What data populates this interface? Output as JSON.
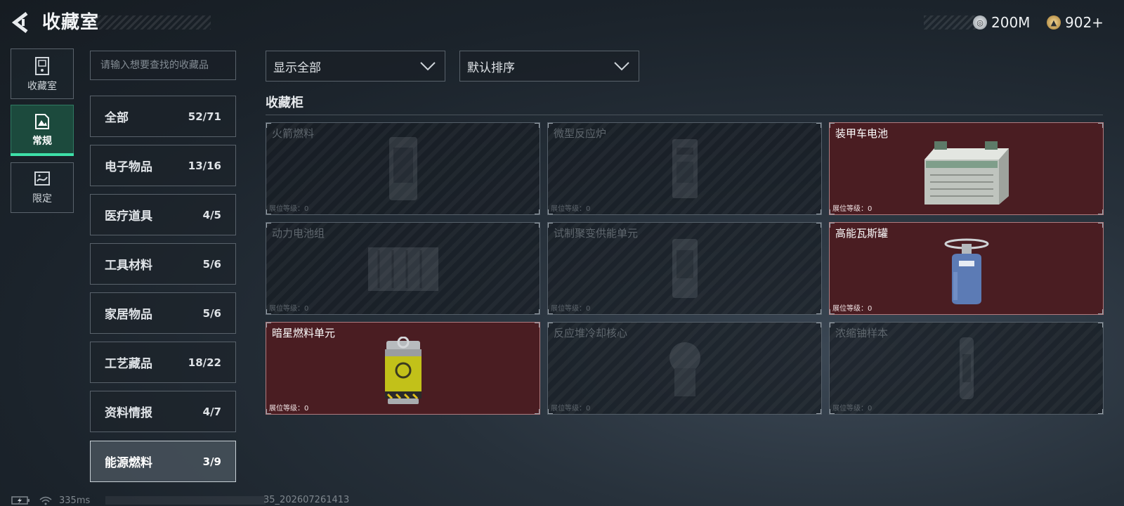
{
  "header": {
    "title": "收藏室"
  },
  "currency": [
    {
      "value": "200M",
      "icon": "silver-coin-icon",
      "color": "#c9ced3"
    },
    {
      "value": "902+",
      "icon": "gold-coin-icon",
      "color": "#d9b36a"
    }
  ],
  "nav": [
    {
      "label": "收藏室",
      "icon": "vault-icon",
      "active": false
    },
    {
      "label": "常规",
      "icon": "regular-icon",
      "active": true
    },
    {
      "label": "限定",
      "icon": "limited-icon",
      "active": false
    }
  ],
  "search": {
    "placeholder": "请输入想要查找的收藏品"
  },
  "categories": [
    {
      "name": "全部",
      "count": "52/71"
    },
    {
      "name": "电子物品",
      "count": "13/16"
    },
    {
      "name": "医疗道具",
      "count": "4/5"
    },
    {
      "name": "工具材料",
      "count": "5/6"
    },
    {
      "name": "家居物品",
      "count": "5/6"
    },
    {
      "name": "工艺藏品",
      "count": "18/22"
    },
    {
      "name": "资料情报",
      "count": "4/7"
    },
    {
      "name": "能源燃料",
      "count": "3/9",
      "active": true
    }
  ],
  "filters": {
    "show": "显示全部",
    "sort": "默认排序"
  },
  "section": {
    "title": "收藏柜"
  },
  "items": [
    {
      "name": "火箭燃料",
      "level": "展位等级：0",
      "owned": false,
      "icon": "rocket-fuel-icon"
    },
    {
      "name": "微型反应炉",
      "level": "展位等级：0",
      "owned": false,
      "icon": "mini-reactor-icon"
    },
    {
      "name": "装甲车电池",
      "level": "展位等级：0",
      "owned": true,
      "icon": "armored-battery-icon"
    },
    {
      "name": "动力电池组",
      "level": "展位等级：0",
      "owned": false,
      "icon": "power-battery-pack-icon"
    },
    {
      "name": "试制聚变供能单元",
      "level": "展位等级：0",
      "owned": false,
      "icon": "fusion-unit-icon"
    },
    {
      "name": "高能瓦斯罐",
      "level": "展位等级：0",
      "owned": true,
      "icon": "gas-canister-icon"
    },
    {
      "name": "暗星燃料单元",
      "level": "展位等级：0",
      "owned": true,
      "icon": "darkstar-fuel-cell-icon"
    },
    {
      "name": "反应堆冷却核心",
      "level": "展位等级：0",
      "owned": false,
      "icon": "reactor-cooling-core-icon"
    },
    {
      "name": "浓缩铀样本",
      "level": "展位等级：0",
      "owned": false,
      "icon": "uranium-sample-icon"
    }
  ],
  "status": {
    "ping": "335ms",
    "build": "35_202607261413"
  }
}
